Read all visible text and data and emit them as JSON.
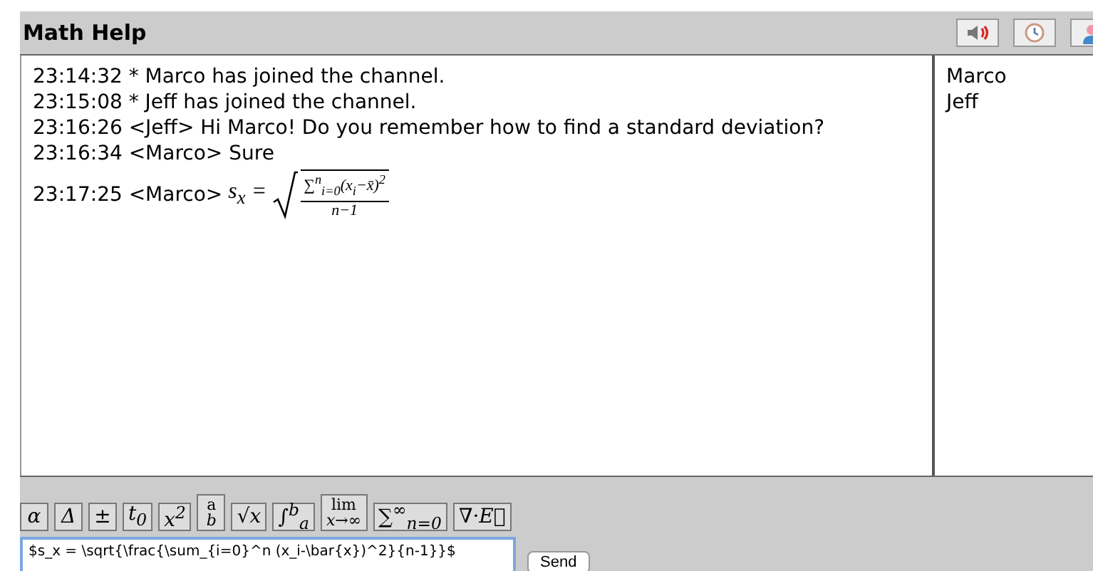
{
  "window": {
    "title": "Math Help"
  },
  "header_buttons": [
    {
      "kind": "speaker"
    },
    {
      "kind": "clock"
    },
    {
      "kind": "user"
    }
  ],
  "messages": [
    {
      "kind": "text",
      "time": "23:14:32",
      "text": "* Marco has joined the channel."
    },
    {
      "kind": "text",
      "time": "23:15:08",
      "text": "* Jeff has joined the channel."
    },
    {
      "kind": "text",
      "time": "23:16:26",
      "text": "<Jeff> Hi Marco! Do you remember how to find a standard deviation?"
    },
    {
      "kind": "text",
      "time": "23:16:34",
      "text": "<Marco> Sure"
    },
    {
      "kind": "formula",
      "time": "23:17:25",
      "text": "<Marco>",
      "lhs": "s$_{x}$ =",
      "numerator": "∑$^{n}$$_{i=0}$(x$_{i}$−x̄)$^{2}$",
      "denominator": "n−1"
    }
  ],
  "users": [
    "Marco",
    "Jeff"
  ],
  "toolbar": [
    {
      "kind": "plain",
      "label": "α"
    },
    {
      "kind": "plain",
      "label": "Δ"
    },
    {
      "kind": "plain",
      "label": "±"
    },
    {
      "kind": "plain",
      "label": "t$_{0}$"
    },
    {
      "kind": "plain",
      "label": "x$^{2}$"
    },
    {
      "kind": "frac",
      "top": "a",
      "bottom": "b"
    },
    {
      "kind": "plain",
      "label": "√x"
    },
    {
      "kind": "plain",
      "label": "∫$^{b}$$_{a}$"
    },
    {
      "kind": "frac",
      "top": "lim",
      "bottom": "x→∞"
    },
    {
      "kind": "plain",
      "label": "∑$^{∞}$$_{n=0}$"
    },
    {
      "kind": "plain",
      "label": "∇·E⃗"
    }
  ],
  "input": {
    "value": "$s_x = \\sqrt{\\frac{\\sum_{i=0}^n (x_i-\\bar{x})^2}{n-1}}$"
  },
  "send_button": {
    "label": "Send"
  }
}
